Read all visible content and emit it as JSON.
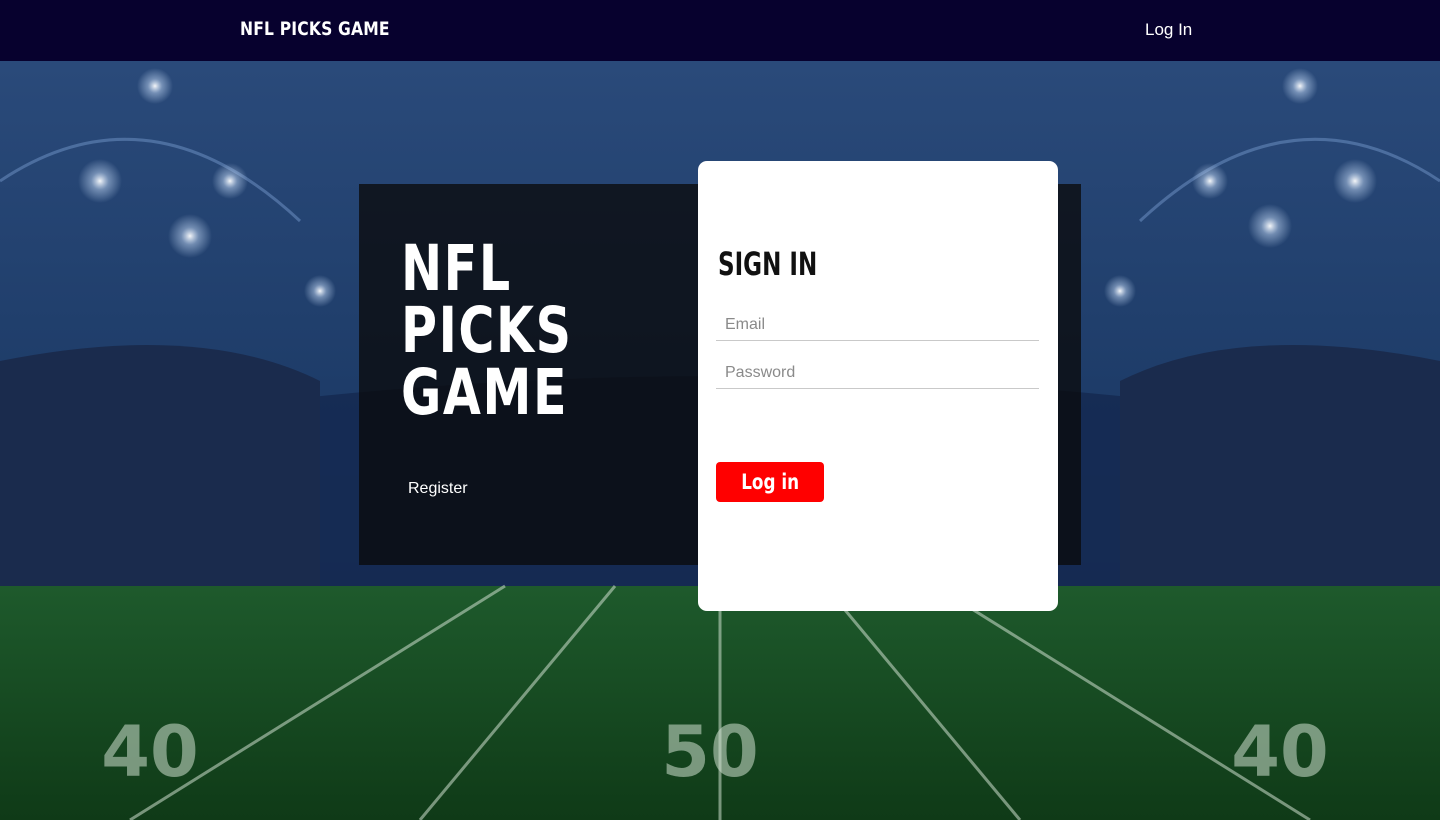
{
  "nav": {
    "brand": "NFL PICKS GAME",
    "login_link": "Log In"
  },
  "hero": {
    "title_lines": [
      "NFL",
      "PICKS",
      "GAME"
    ],
    "register_link": "Register"
  },
  "background": {
    "field_numbers": [
      "40",
      "50",
      "40"
    ]
  },
  "signin": {
    "title": "SIGN IN",
    "email_placeholder": "Email",
    "password_placeholder": "Password",
    "submit_label": "Log in"
  },
  "colors": {
    "nav_bg": "#07012e",
    "button": "#ff0000",
    "card": "#ffffff"
  }
}
